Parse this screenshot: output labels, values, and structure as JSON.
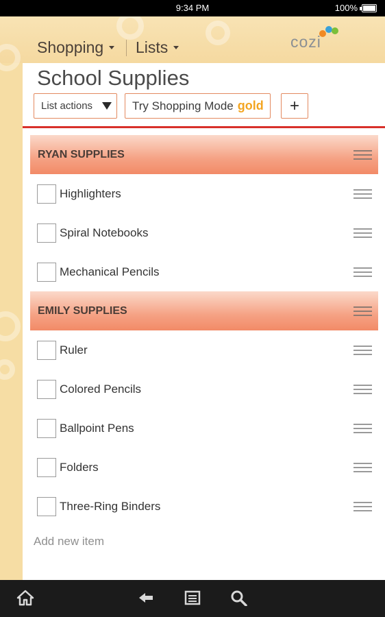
{
  "status": {
    "time": "9:34 PM",
    "battery": "100%"
  },
  "nav": {
    "shopping": "Shopping",
    "lists": "Lists",
    "logo": "cozi"
  },
  "list": {
    "title": "School Supplies",
    "actions_label": "List actions",
    "shopping_mode_label": "Try Shopping Mode",
    "gold_label": "gold",
    "add_label": "+",
    "add_item_placeholder": "Add new item",
    "sections": [
      {
        "name": "RYAN SUPPLIES",
        "items": [
          "Highlighters",
          "Spiral Notebooks",
          "Mechanical Pencils"
        ]
      },
      {
        "name": "EMILY SUPPLIES",
        "items": [
          "Ruler",
          "Colored Pencils",
          "Ballpoint Pens",
          "Folders",
          "Three-Ring Binders"
        ]
      }
    ]
  },
  "colors": {
    "accent": "#d8302a",
    "section": "#f5a284",
    "gold": "#f3a521"
  },
  "bottom_nav": [
    "home-icon",
    "back-icon",
    "menu-icon",
    "search-icon"
  ]
}
